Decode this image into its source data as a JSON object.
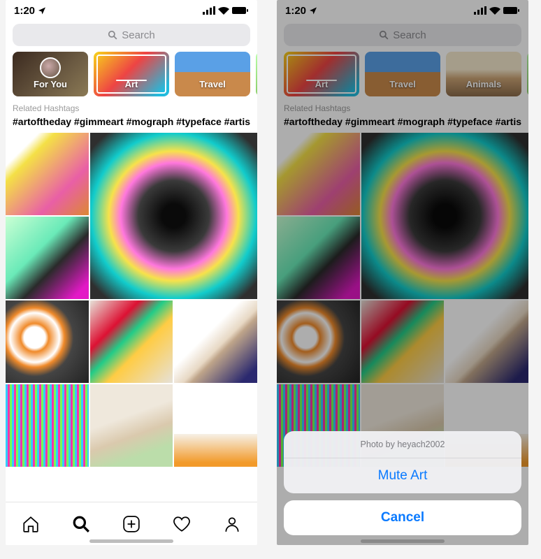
{
  "status": {
    "time": "1:20"
  },
  "search": {
    "placeholder": "Search"
  },
  "left": {
    "categories": [
      {
        "label": "For You",
        "kind": "forYou",
        "selected": false,
        "avatar": true
      },
      {
        "label": "Art",
        "kind": "art",
        "selected": true,
        "avatar": false
      },
      {
        "label": "Travel",
        "kind": "travel",
        "selected": false,
        "avatar": false
      }
    ]
  },
  "right": {
    "categories": [
      {
        "label": "Art",
        "kind": "art",
        "selected": true,
        "avatar": false
      },
      {
        "label": "Travel",
        "kind": "travel",
        "selected": false,
        "avatar": false
      },
      {
        "label": "Animals",
        "kind": "animals",
        "selected": false,
        "avatar": false
      }
    ]
  },
  "related_label": "Related Hashtags",
  "hashtags": "#artoftheday  #gimmeart  #mograph  #typeface  #artis",
  "sheet": {
    "title": "Photo by heyach2002",
    "action": "Mute Art",
    "cancel": "Cancel"
  },
  "colors": {
    "ios_blue": "#0a7aff"
  }
}
